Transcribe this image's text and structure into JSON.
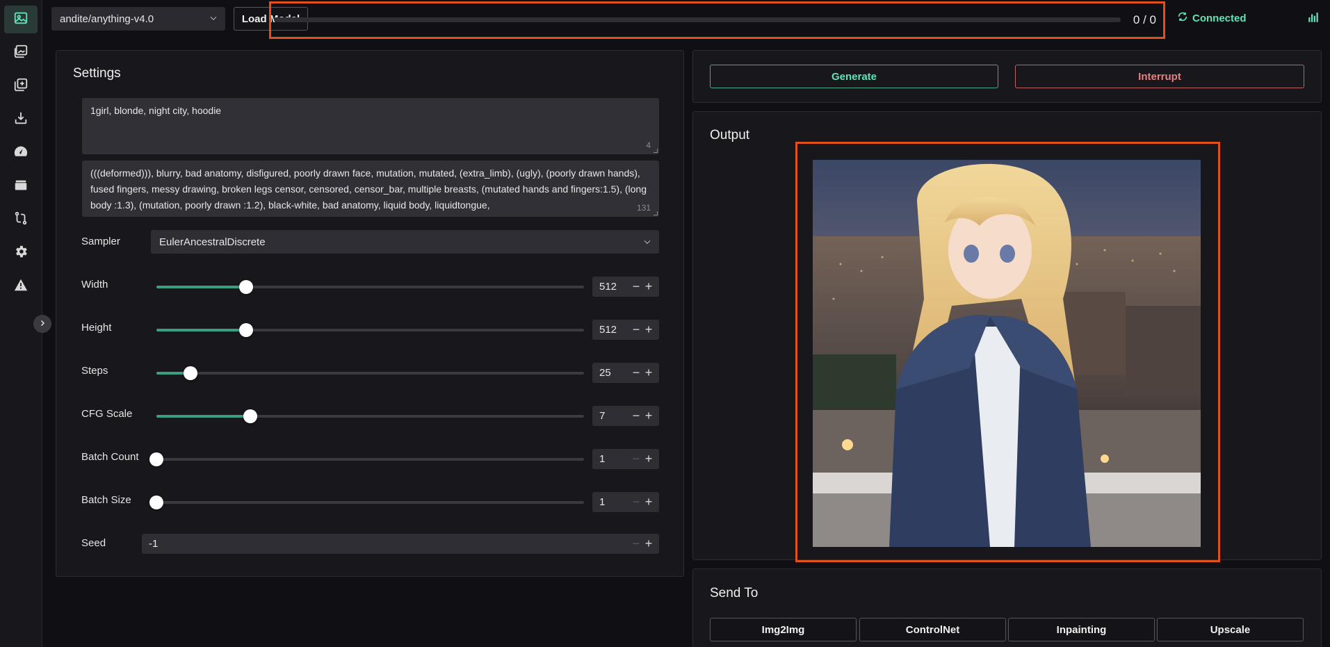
{
  "sidebar": {
    "items": [
      {
        "name": "txt2img-icon",
        "active": true
      },
      {
        "name": "img2img-icon"
      },
      {
        "name": "extra-icon"
      },
      {
        "name": "download-icon"
      },
      {
        "name": "speedometer-icon"
      },
      {
        "name": "models-icon"
      },
      {
        "name": "convert-icon"
      },
      {
        "name": "settings-gear-icon"
      },
      {
        "name": "warning-icon"
      }
    ]
  },
  "topbar": {
    "model": "andite/anything-v4.0",
    "load_label": "Load Model",
    "progress_value": 0,
    "progress_text": "0 / 0",
    "connection": "Connected"
  },
  "settings": {
    "title": "Settings",
    "prompt": "1girl, blonde, night city, hoodie",
    "prompt_count": "4",
    "negative_prompt": "(((deformed))), blurry, bad anatomy, disfigured, poorly drawn face, mutation, mutated, (extra_limb), (ugly), (poorly drawn hands), fused fingers, messy drawing, broken legs censor, censored, censor_bar, multiple breasts, (mutated hands and fingers:1.5), (long body :1.3), (mutation, poorly drawn :1.2), black-white, bad anatomy, liquid body, liquidtongue,",
    "negative_count": "131",
    "sampler_label": "Sampler",
    "sampler_value": "EulerAncestralDiscrete",
    "width": {
      "label": "Width",
      "value": "512",
      "fraction": 0.21
    },
    "height": {
      "label": "Height",
      "value": "512",
      "fraction": 0.21
    },
    "steps": {
      "label": "Steps",
      "value": "25",
      "fraction": 0.08
    },
    "cfg": {
      "label": "CFG Scale",
      "value": "7",
      "fraction": 0.22
    },
    "batch_count": {
      "label": "Batch Count",
      "value": "1",
      "fraction": 0.0
    },
    "batch_size": {
      "label": "Batch Size",
      "value": "1",
      "fraction": 0.0
    },
    "seed": {
      "label": "Seed",
      "value": "-1"
    }
  },
  "actions": {
    "generate": "Generate",
    "interrupt": "Interrupt"
  },
  "output": {
    "title": "Output"
  },
  "send_to": {
    "title": "Send To",
    "buttons": [
      "Img2Img",
      "ControlNet",
      "Inpainting",
      "Upscale"
    ]
  },
  "colors": {
    "accent": "#63e2b7",
    "danger": "#e88080",
    "highlight": "#e0521d"
  }
}
